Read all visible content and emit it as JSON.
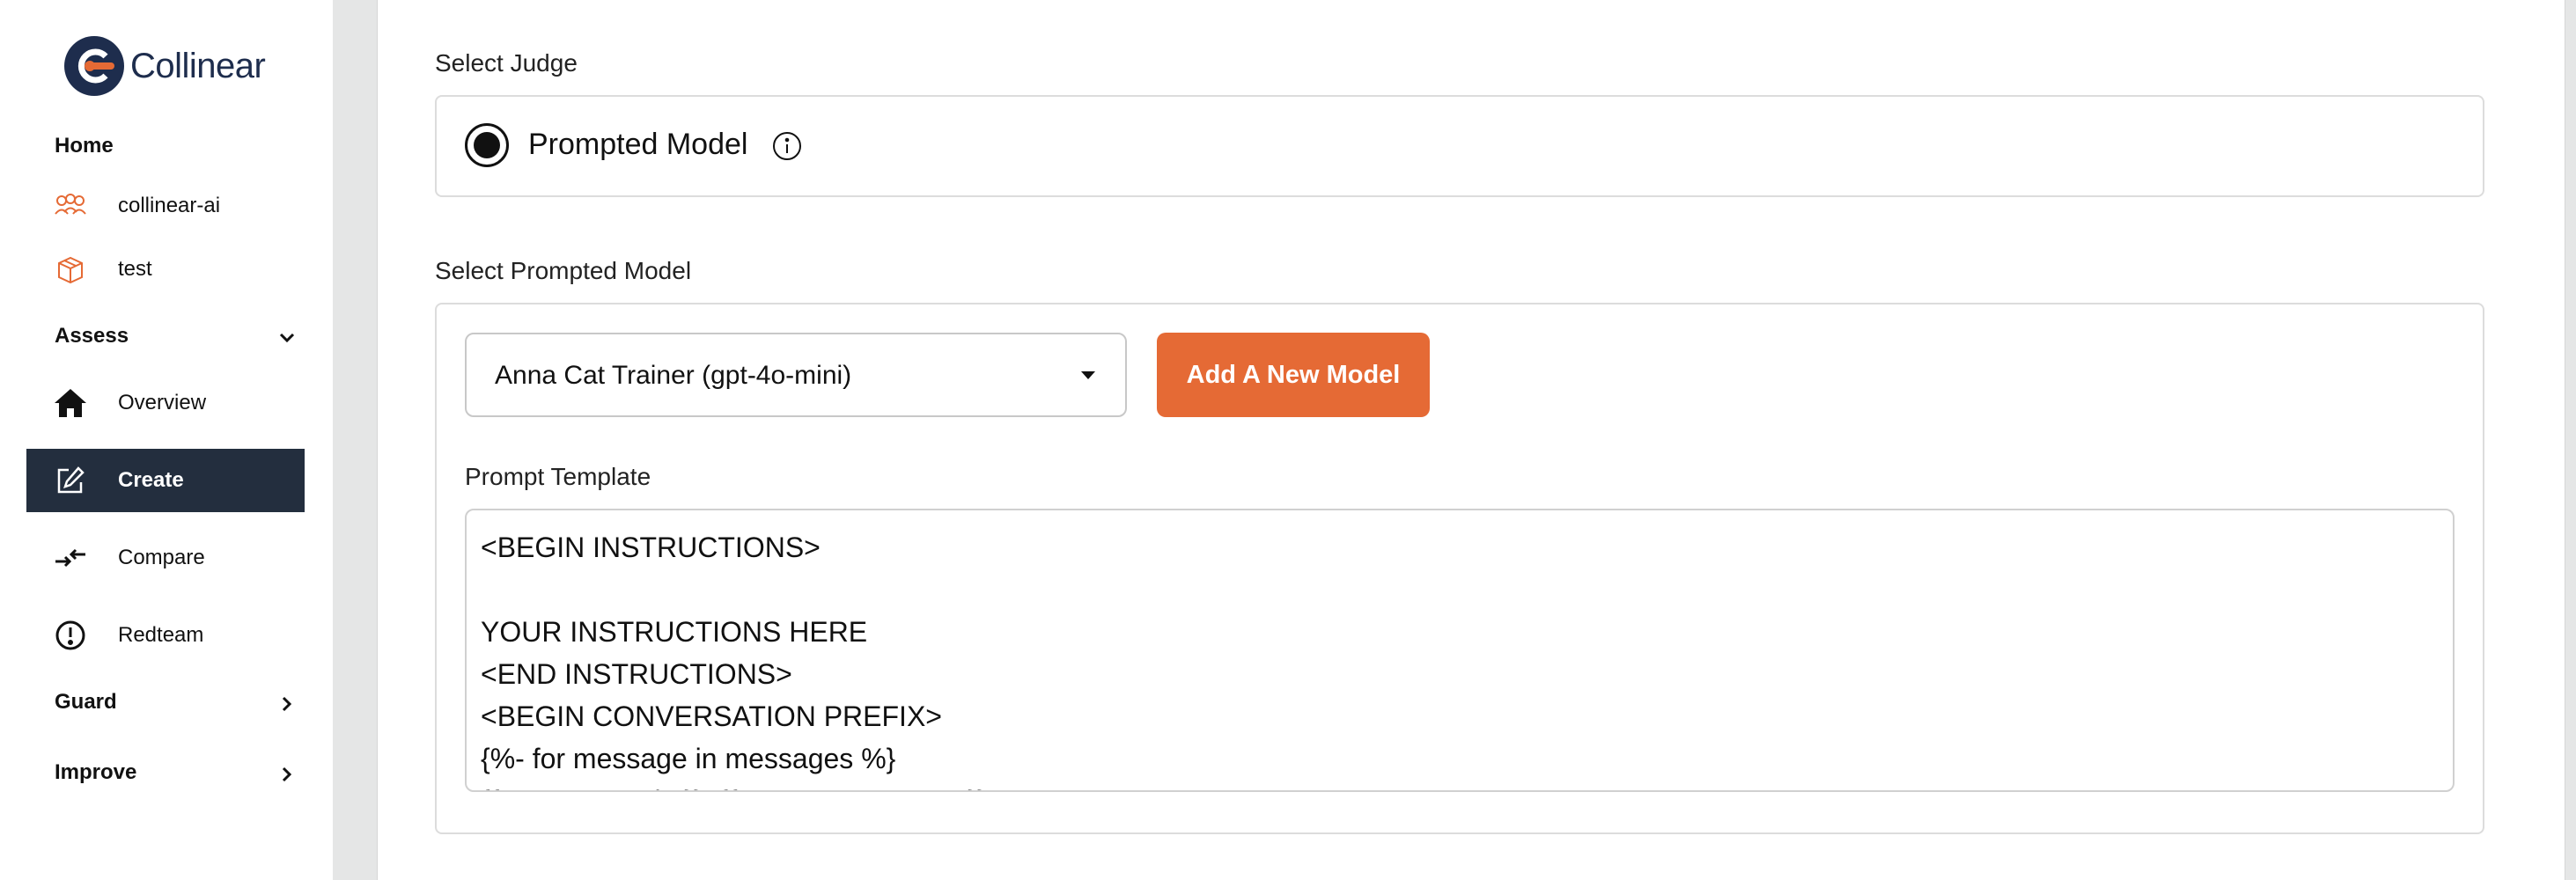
{
  "app": {
    "logo_text": "Collinear",
    "accent_color": "#e56a35",
    "nav_active_bg": "#232e3e"
  },
  "sidebar": {
    "home_label": "Home",
    "spaces": [
      {
        "label": "collinear-ai",
        "icon": "team-icon"
      },
      {
        "label": "test",
        "icon": "box-icon"
      }
    ],
    "assess": {
      "label": "Assess",
      "expanded": true,
      "items": [
        {
          "label": "Overview",
          "icon": "home-icon",
          "active": false
        },
        {
          "label": "Create",
          "icon": "edit-icon",
          "active": true
        },
        {
          "label": "Compare",
          "icon": "compare-arrows-icon",
          "active": false
        },
        {
          "label": "Redteam",
          "icon": "alert-circle-icon",
          "active": false
        }
      ]
    },
    "guard": {
      "label": "Guard",
      "expanded": false
    },
    "improve": {
      "label": "Improve",
      "expanded": false
    }
  },
  "main": {
    "judge": {
      "section_label": "Select Judge",
      "option_label": "Prompted Model",
      "selected": true
    },
    "prompted_model": {
      "section_label": "Select Prompted Model",
      "selected_value": "Anna Cat Trainer (gpt-4o-mini)",
      "add_button_label": "Add A New Model"
    },
    "prompt_template": {
      "label": "Prompt Template",
      "lines": [
        "<BEGIN INSTRUCTIONS>",
        "",
        "YOUR INSTRUCTIONS HERE",
        "<END INSTRUCTIONS>",
        "<BEGIN CONVERSATION PREFIX>",
        "{%- for message in messages %}",
        "{{ message.role }}: {{ message.content }}"
      ]
    }
  }
}
